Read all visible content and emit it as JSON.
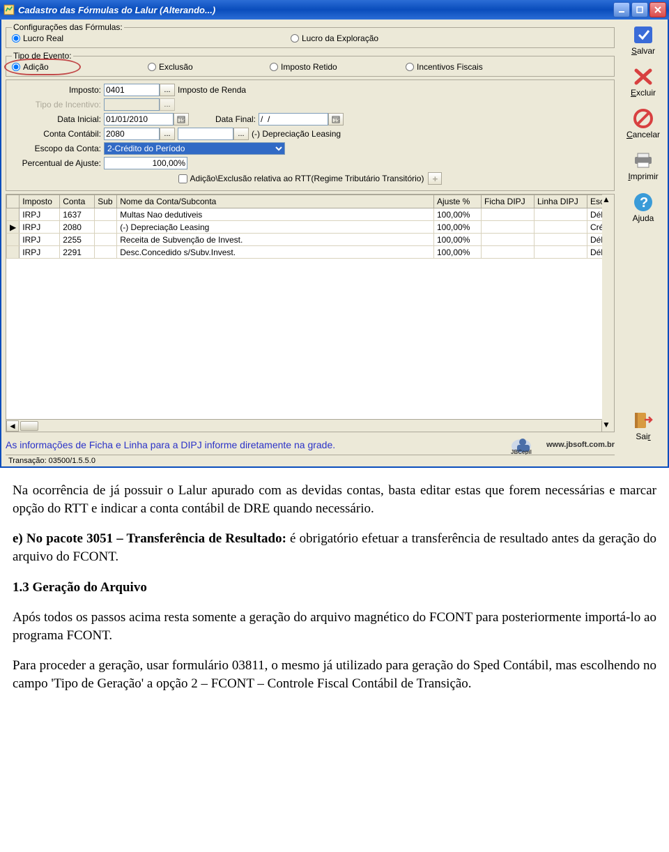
{
  "title": "Cadastro das Fórmulas do Lalur (Alterando...)",
  "config_legend": "Configurações das Fórmulas:",
  "config_opts": {
    "lucro_real": "Lucro Real",
    "lucro_exploracao": "Lucro da Exploração"
  },
  "evento_legend": "Tipo de Evento:",
  "evento_opts": {
    "adicao": "Adição",
    "exclusao": "Exclusão",
    "imposto_retido": "Imposto Retido",
    "incentivos": "Incentivos Fiscais"
  },
  "labels": {
    "imposto": "Imposto:",
    "tipo_incentivo": "Tipo de Incentivo:",
    "data_inicial": "Data Inicial:",
    "data_final": "Data Final:",
    "conta_contabil": "Conta Contábil:",
    "escopo": "Escopo da Conta:",
    "percentual": "Percentual de Ajuste:"
  },
  "values": {
    "imposto_code": "0401",
    "imposto_desc": "Imposto de Renda",
    "data_inicial": "01/01/2010",
    "data_final": "/  /",
    "conta_code": "2080",
    "conta_desc": "(-) Depreciação Leasing",
    "escopo": "2-Crédito do Período",
    "percentual": "100,00%"
  },
  "rtt_checkbox": "Adição\\Exclusão relativa ao RTT(Regime Tributário Transitório)",
  "grid": {
    "headers": [
      "Imposto",
      "Conta",
      "Sub",
      "Nome da Conta/Subconta",
      "Ajuste %",
      "Ficha DIPJ",
      "Linha DIPJ",
      "Esc"
    ],
    "rows": [
      {
        "indicator": "",
        "cells": [
          "IRPJ",
          "1637",
          "",
          "Multas Nao dedutiveis",
          "100,00%",
          "",
          "",
          "Déb"
        ]
      },
      {
        "indicator": "▶",
        "cells": [
          "IRPJ",
          "2080",
          "",
          "(-) Depreciação Leasing",
          "100,00%",
          "",
          "",
          "Créd"
        ]
      },
      {
        "indicator": "",
        "cells": [
          "IRPJ",
          "2255",
          "",
          "Receita de Subvenção de Invest.",
          "100,00%",
          "",
          "",
          "Déb"
        ]
      },
      {
        "indicator": "",
        "cells": [
          "IRPJ",
          "2291",
          "",
          "Desc.Concedido s/Subv.Invest.",
          "100,00%",
          "",
          "",
          "Déb"
        ]
      }
    ]
  },
  "info_bar": "As informações de Ficha e Linha para a DIPJ informe diretamente na grade.",
  "status_bar": "Transação: 03500/1.5.5.0",
  "side": {
    "salvar": "Salvar",
    "excluir": "Excluir",
    "cancelar": "Cancelar",
    "imprimir": "Imprimir",
    "ajuda": "Ajuda",
    "sair": "Sair"
  },
  "logo": {
    "name": "JBCepil",
    "url": "www.jbsoft.com.br"
  },
  "document": {
    "p1": "Na ocorrência de já possuir o Lalur apurado com as devidas contas, basta editar estas que forem necessárias e marcar opção do RTT e indicar a conta contábil de DRE quando necessário.",
    "p2a": "e) No pacote 3051 – Transferência de Resultado:",
    "p2b": " é obrigatório efetuar a transferência de resultado antes da geração do arquivo do FCONT.",
    "h1": "1.3 Geração do Arquivo",
    "p3": "Após todos os passos acima resta somente a geração do arquivo magnético do FCONT para posteriormente importá-lo ao programa FCONT.",
    "p4": "Para proceder a geração, usar  formulário 03811, o mesmo já utilizado para geração do Sped Contábil, mas escolhendo no campo 'Tipo de Geração' a opção 2 – FCONT – Controle Fiscal Contábil de Transição."
  }
}
